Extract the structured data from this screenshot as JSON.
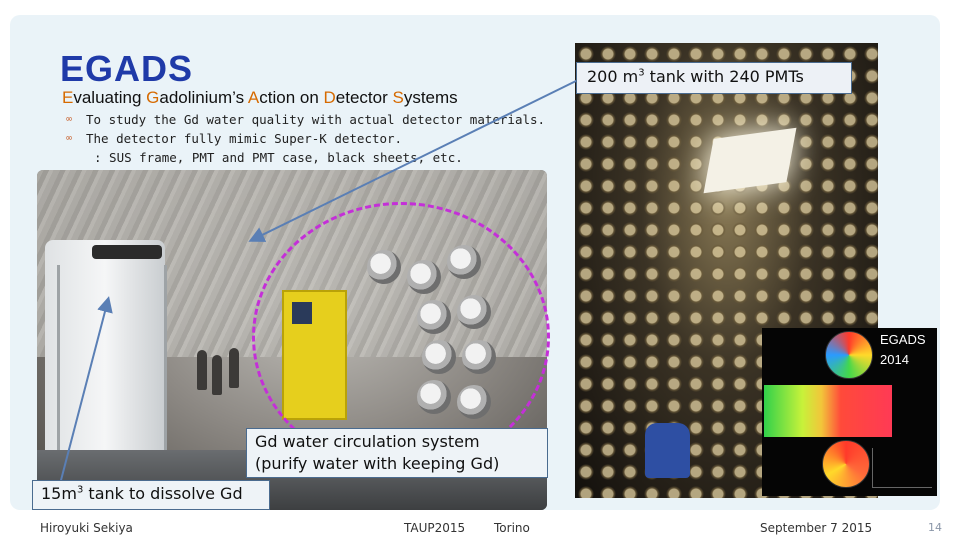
{
  "slide": {
    "title": "EGADS",
    "subtitle": {
      "parts": [
        {
          "cap": "E",
          "rest": "valuating "
        },
        {
          "cap": "G",
          "rest": "adolinium’s "
        },
        {
          "cap": "A",
          "rest": "ction on "
        },
        {
          "cap": "D",
          "rest": "etector "
        },
        {
          "cap": "S",
          "rest": "ystems"
        }
      ]
    },
    "bullets": [
      "To study the Gd water quality with actual detector materials.",
      "The detector fully mimic Super-K detector."
    ],
    "bullet_continuation": ": SUS frame, PMT and PMT case, black sheets, etc.",
    "callouts": {
      "tank200_pre": "200 m",
      "tank200_sup": "3",
      "tank200_post": " tank with 240 PMTs",
      "gd_line1": "Gd water circulation system",
      "gd_line2": "(purify water with keeping Gd)",
      "tank15_pre": "15m",
      "tank15_sup": "3",
      "tank15_post": " tank to dissolve Gd"
    },
    "inset": {
      "label_line1": "EGADS",
      "label_line2": "2014"
    },
    "colors": {
      "title": "#1f3aa8",
      "subtitle_caps": "#d66a00",
      "circle_highlight": "#c42fd8",
      "arrow": "#5a7fb5"
    },
    "icons": [
      "bullet-icon"
    ]
  },
  "footer": {
    "author": "Hiroyuki Sekiya",
    "conference": "TAUP2015",
    "city": "Torino",
    "date": "September 7 2015",
    "page": "14"
  }
}
